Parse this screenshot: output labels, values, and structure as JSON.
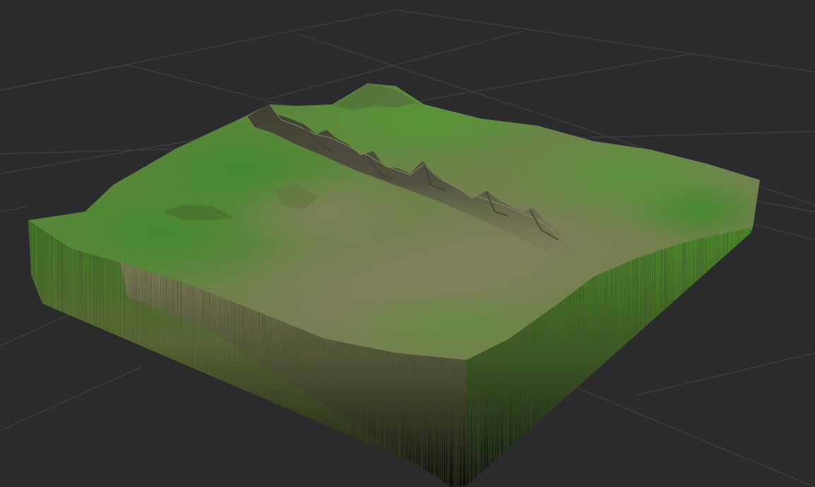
{
  "viewport": {
    "background_color": "#2b2b2d",
    "grid_line_color": "#3e3e41",
    "grid": "on",
    "projection": "perspective"
  },
  "terrain": {
    "surface_low_color": "#3f8f2a",
    "surface_mid_color": "#6b7a48",
    "surface_high_color": "#6f6a5e",
    "ridge_dark_color": "#3a3430",
    "ridge_light_color": "#8f8878",
    "skirt_top_color": "#5d6b3a",
    "skirt_bottom_color": "#0f100b"
  }
}
